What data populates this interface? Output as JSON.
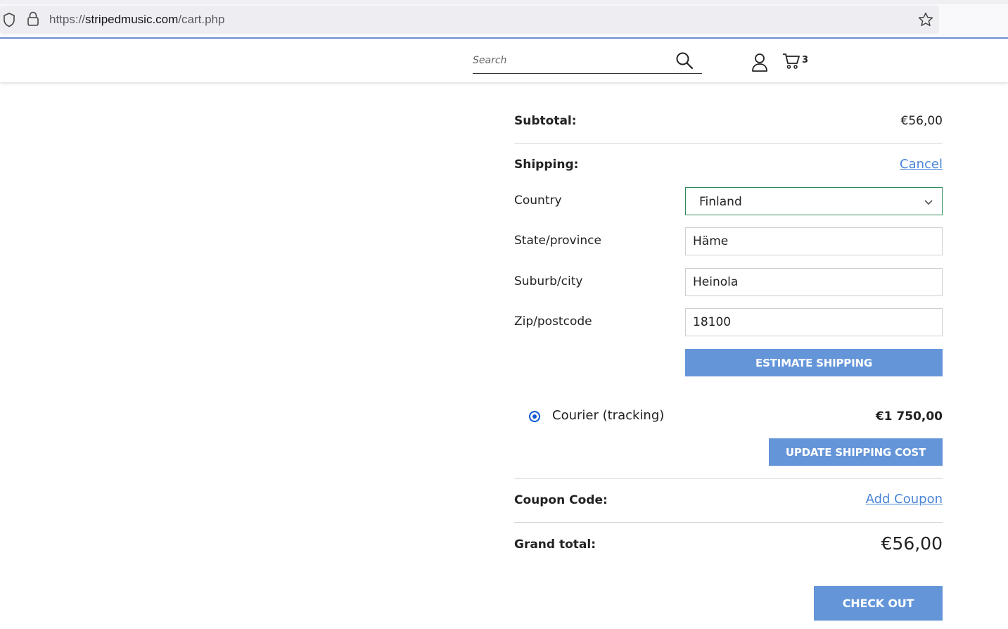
{
  "browser": {
    "url_scheme": "https://",
    "url_host": "stripedmusic.com",
    "url_path": "/cart.php"
  },
  "header": {
    "search_placeholder": "Search",
    "cart_count": "3"
  },
  "totals": {
    "subtotal_label": "Subtotal:",
    "subtotal_value": "€56,00",
    "shipping_label": "Shipping:",
    "cancel_link": "Cancel",
    "country_label": "Country",
    "country_value": "Finland",
    "state_label": "State/province",
    "state_value": "Häme",
    "city_label": "Suburb/city",
    "city_value": "Heinola",
    "zip_label": "Zip/postcode",
    "zip_value": "18100",
    "estimate_button": "Estimate Shipping",
    "courier_label": "Courier (tracking)",
    "courier_price": "€1 750,00",
    "update_button": "Update Shipping Cost",
    "coupon_label": "Coupon Code:",
    "add_coupon_link": "Add Coupon",
    "grand_total_label": "Grand total:",
    "grand_total_value": "€56,00",
    "checkout_button": "Check Out"
  },
  "colors": {
    "accent_button": "#6495d9",
    "link": "#4a86d8",
    "select_border": "#2e8b57"
  }
}
